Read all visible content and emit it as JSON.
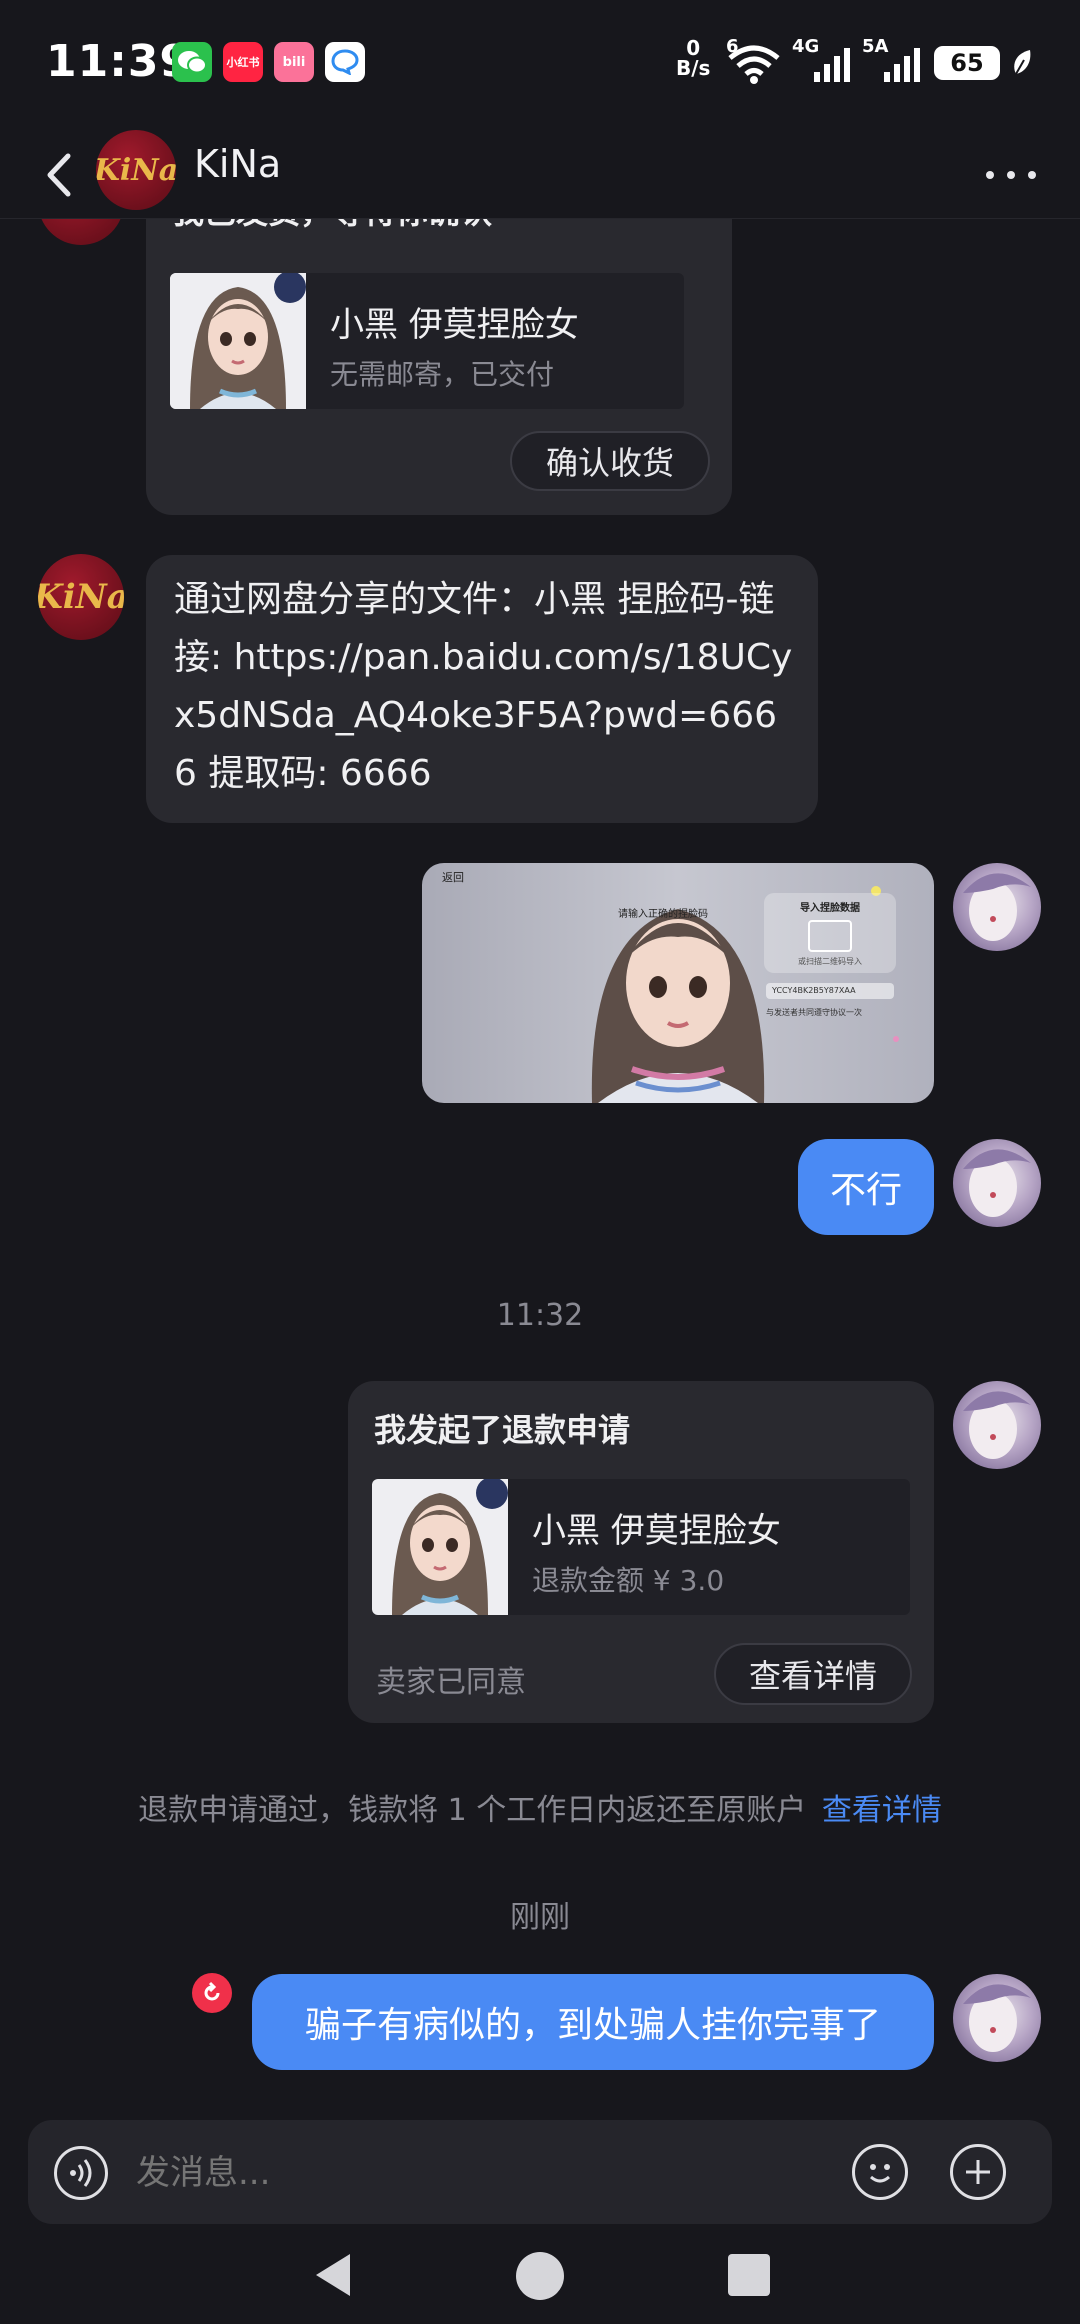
{
  "status_bar": {
    "time": "11:39",
    "apps": [
      {
        "name": "wechat-icon",
        "color": "#2bc14d",
        "label": ""
      },
      {
        "name": "xiaohongshu-icon",
        "color": "#ff2442",
        "label": "小红书"
      },
      {
        "name": "bilibili-icon",
        "color": "#fb7299",
        "label": "bili"
      },
      {
        "name": "chat-bubble-app-icon",
        "color": "#ffffff",
        "label": ""
      }
    ],
    "net_speed_value": "0",
    "net_speed_unit": "B/s",
    "wifi_badge": "6",
    "cell1_label": "4G",
    "cell2_label": "5A",
    "battery": "65"
  },
  "header": {
    "contact_name": "KiNa",
    "avatar_text": "KiNa"
  },
  "messages": {
    "shipped_card": {
      "title": "我已发货，等待你确认",
      "product_name": "小黑 伊莫捏脸女",
      "product_sub": "无需邮寄，已交付",
      "confirm_button": "确认收货"
    },
    "share_text": "通过网盘分享的文件：小黑 捏脸码-链接: https://pan.baidu.com/s/18UCyx5dNSda_AQ4oke3F5A?pwd=6666 提取码: 6666",
    "screenshot_image": {
      "top_left": "返回",
      "prompt": "请输入正确的捏脸码",
      "panel_title": "导入捏脸数据",
      "panel_sub": "或扫描二维码导入",
      "code_field": "YCCY4BK2B5Y87XAA",
      "note": "与发送者共同遵守协议一次"
    },
    "reply_no": "不行",
    "time_1": "11:32",
    "refund_card": {
      "title": "我发起了退款申请",
      "product_name": "小黑 伊莫捏脸女",
      "refund_amount": "退款金额 ¥ 3.0",
      "status": "卖家已同意",
      "details_button": "查看详情"
    },
    "system_notice": "退款申请通过，钱款将 1 个工作日内返还至原账户",
    "system_notice_link": "查看详情",
    "time_2": "刚刚",
    "last_message": "骗子有病似的，到处骗人挂你完事了"
  },
  "input": {
    "placeholder": "发消息..."
  },
  "colors": {
    "background": "#17171c",
    "bubble_dark": "#29292f",
    "bubble_blue": "#4a8af4",
    "link_blue": "#4a8af4",
    "error_red": "#f0304a"
  }
}
